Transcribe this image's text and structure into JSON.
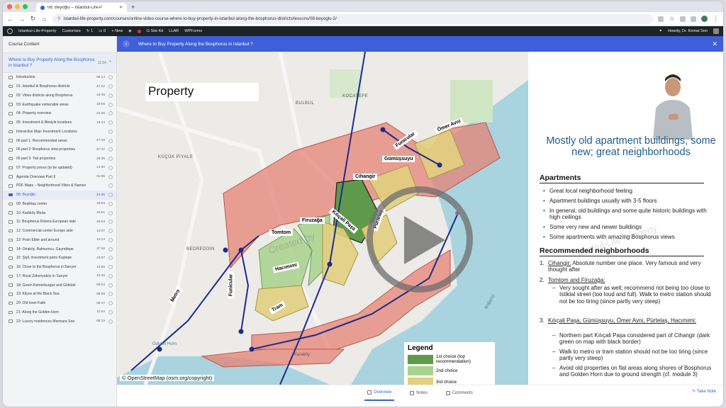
{
  "browser": {
    "tab_title": "08: Beyoğlu – Istanbul-Life-P",
    "url": "istanbul-life-property.com/courses/online-video-course-where-to-buy-property-in-istanbul-along-the-bosphorus-districts/lessons/08-beyoglu-2/",
    "lights": [
      "#ff5f57",
      "#febc2e",
      "#28c840"
    ]
  },
  "wpbar": {
    "site": "Istanbul-Life-Property",
    "customize": "Customize",
    "comments": "1",
    "updates": "0",
    "new": "+ New",
    "sitekit": "Site Kit",
    "llar": "LLAR",
    "wpforms": "WPForms",
    "howdy": "Howdy, Dr. Kemal Sen"
  },
  "sidebar": {
    "header": "Course Content",
    "course_title": "Where to Buy Property Along the Bosphorus in Istanbul ?",
    "course_duration": "11:34",
    "lessons": [
      {
        "title": "Introduction",
        "duration": "09:14"
      },
      {
        "title": "01: Istanbul & Bosphorus districts",
        "duration": "47:22"
      },
      {
        "title": "02: Vibes districts along Bosphorus",
        "duration": "43:49"
      },
      {
        "title": "03: Earthquake vulnerable areas",
        "duration": "19:06"
      },
      {
        "title": "04: Property overview",
        "duration": "22:26"
      },
      {
        "title": "05: Investment & lifestyle locations",
        "duration": "19:44"
      },
      {
        "title": "Interactive Map: Investment Locations",
        "duration": ""
      },
      {
        "title": "06 part 1: Recommended areas",
        "duration": "47:15"
      },
      {
        "title": "06 part 2: Bosphorus view properties",
        "duration": "37:47"
      },
      {
        "title": "06 part 3: Yalı properties",
        "duration": "29:36"
      },
      {
        "title": "07: Property prices (to be updated)",
        "duration": "14:30"
      },
      {
        "title": "Agenda Overview Part II",
        "duration": "01:06"
      },
      {
        "title": "PDF Maps – Neighborhood Vibes & Names",
        "duration": ""
      },
      {
        "title": "08: Beyoğlu",
        "duration": "24:45",
        "active": true
      },
      {
        "title": "09: Beşiktaş center",
        "duration": "19:04"
      },
      {
        "title": "10: Kadıköy Moda",
        "duration": "16:51"
      },
      {
        "title": "11: Bosphorus Riviera European side",
        "duration": "49:54"
      },
      {
        "title": "12: Commercial center Europe side",
        "duration": "14:07"
      },
      {
        "title": "13: Posh Etiler and around",
        "duration": "14:14"
      },
      {
        "title": "14: Ortaköy, Balmumcu, Gayrettepe",
        "duration": "27:32"
      },
      {
        "title": "15: Şişli, investment parts Kuştepe",
        "duration": "19:07"
      },
      {
        "title": "16: Close to the Bosphorus in Sarıyer",
        "duration": "13:56"
      },
      {
        "title": "17: Rural Zekeriyaköy in Sarıyer",
        "duration": "10:40"
      },
      {
        "title": "18: Green Kemerburgaz and Göktürk",
        "duration": "06:04"
      },
      {
        "title": "19: Kilyos at the Black Sea",
        "duration": "08:08"
      },
      {
        "title": "20: Old town Fatih",
        "duration": "09:47"
      },
      {
        "title": "21: Along the Golden Horn",
        "duration": "11:54"
      },
      {
        "title": "22: Luxury residences Marmara Sea",
        "duration": "08:19"
      }
    ]
  },
  "topic": {
    "title": "Where to Buy Property Along the Bosphorus in Istanbul ?"
  },
  "map": {
    "title": "Property",
    "watermark": "Created by",
    "credit": "© OpenStreetMap (osm.org/copyright)",
    "areas": [
      "Cihangir",
      "Gümüşsuyu",
      "Ömer Avni",
      "Firuzağa",
      "Tomtom",
      "Kılıçali Paşa",
      "Pürtelaş",
      "Hacımimi"
    ],
    "lines": [
      "Funicular",
      "Funicular",
      "Metro",
      "Tram"
    ],
    "places": [
      "KÜÇÜK PİYALE",
      "BEDREDDİN",
      "BULBUL",
      "KOCATEPE",
      "Golden Horn",
      "Boğaziçi",
      "Karaköy"
    ],
    "legend": {
      "title": "Legend",
      "items": [
        {
          "label": "1st choice (top recommendation)",
          "color": "#5f9a4c"
        },
        {
          "label": "2nd choice",
          "color": "#a8d28c"
        },
        {
          "label": "3rd choice",
          "color": "#e2cf80"
        }
      ]
    }
  },
  "slide": {
    "heading": "Mostly old apartment buildings, some new; great neighborhoods",
    "watermark": "Istanbul-Life-Property",
    "sec1": "Apartments",
    "bullets": [
      "Great local neighborhood feeling",
      "Apartment buildings usually with 3-5 floors",
      "In general, old buildings and some quite historic buildings with high ceilings",
      "Some very new and newer buildings",
      "Some apartments with amazing Bosphorus views"
    ],
    "sec2": "Recommended neighborhoods",
    "rec1_title": "Cihangir:",
    "rec1_text": "Absolute number one place. Very famous and very thought after",
    "rec2_title": "Tomtom and Firuzağa:",
    "rec2_dash": "Very sought after as well; recommend not being too close to Istiklal street (too loud and full). Walk to metro station should not be too tiring (since partly very steep)",
    "rec3_title": "Kılıçali Paşa, Gümüşsuyu, Ömer Avni, Pürtelaş, Hacımimi:",
    "rec3_dash1": "Northern part Kılıçali Paşa considered part of Cihangir (dark green on map with black border)",
    "rec3_dash2": "Walk to metro or tram station should not be too tiring (since partly very steep)",
    "rec3_dash3": "Avoid old properties on flat areas along shores of Bosphorus and Golden Horn due to ground strength (cf. module 3)"
  },
  "bottom_tabs": {
    "overview": "Overview",
    "notes": "Notes",
    "comments": "Comments",
    "take_note": "Take Note"
  }
}
